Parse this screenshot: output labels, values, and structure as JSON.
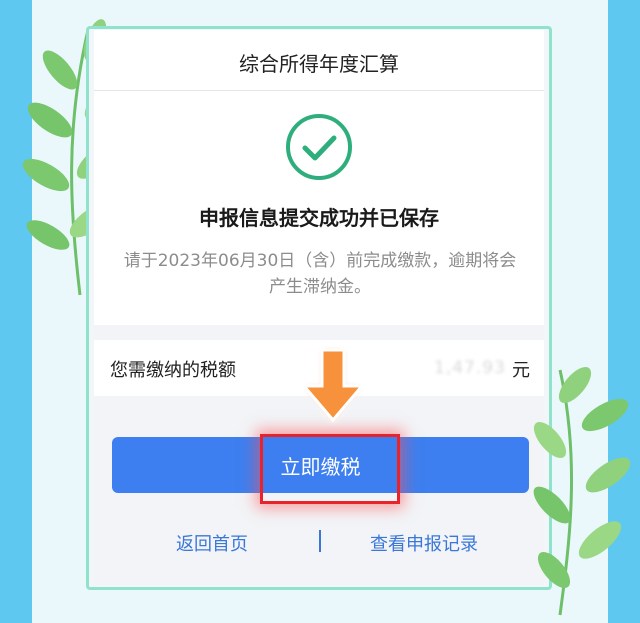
{
  "page": {
    "title": "综合所得年度汇算",
    "status_headline": "申报信息提交成功并已保存",
    "notice": "请于2023年06月30日（含）前完成缴款，逾期将会产生滞纳金。",
    "tax_row": {
      "label": "您需缴纳的税额",
      "amount": "1,47.93",
      "unit": "元"
    },
    "primary_button": "立即缴税",
    "links": {
      "home": "返回首页",
      "records": "查看申报记录"
    }
  },
  "colors": {
    "background": "#5fc8f0",
    "check_green": "#2fae7d",
    "button_blue": "#3d7ff0",
    "link_blue": "#3a78d8",
    "highlight_red": "#e8242a",
    "arrow_orange": "#f7913a"
  },
  "icons": [
    "success-check-icon",
    "arrow-down-icon",
    "leaf-decoration-icon"
  ]
}
